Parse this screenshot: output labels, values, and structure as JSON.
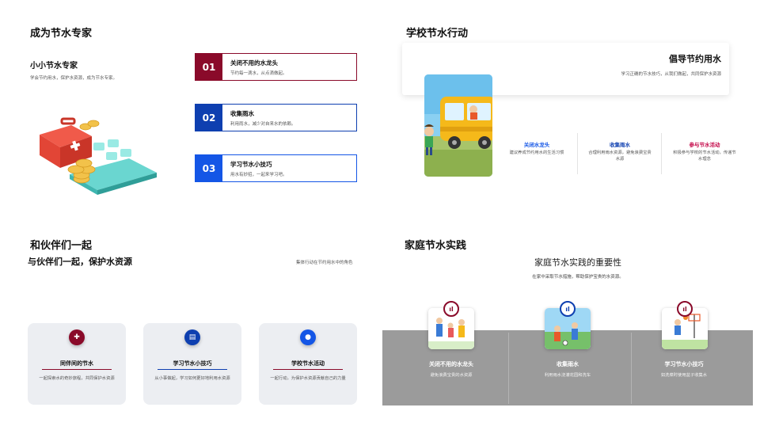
{
  "q1": {
    "title": "成为节水专家",
    "subtitle": "小小节水专家",
    "desc": "学会节约用水，保护水资源，成为节水专家。",
    "steps": [
      {
        "num": "01",
        "title": "关闭不用的水龙头",
        "desc": "节约每一滴水，从点滴做起。",
        "color": "#8a0a2a"
      },
      {
        "num": "02",
        "title": "收集雨水",
        "desc": "利用雨水，减少对自来水的依赖。",
        "color": "#0e3fb0"
      },
      {
        "num": "03",
        "title": "学习节水小技巧",
        "desc": "用水有妙招，一起来学习吧。",
        "color": "#1456e6"
      }
    ]
  },
  "q2": {
    "title": "学校节水行动",
    "card_title": "倡导节约用水",
    "card_desc": "学习正确的节水技巧，从我们做起，共同保护水资源",
    "cols": [
      {
        "title": "关闭水龙头",
        "desc": "建议养成节约用水的生活习惯",
        "color": "#1456e6"
      },
      {
        "title": "收集雨水",
        "desc": "合理利用雨水资源，避免浪费宝贵水源",
        "color": "#0e3fb0"
      },
      {
        "title": "参与节水活动",
        "desc": "积极参与学校的节水活动，传递节水理念",
        "color": "#c40a4a"
      }
    ]
  },
  "q3": {
    "title": "和伙伴们一起",
    "subtitle": "与伙伴们一起，保护水资源",
    "note": "集体行动在节约用水中的角色",
    "cards": [
      {
        "title": "同伴间的节水",
        "desc": "一起探索水的奇妙旅程，共同保护水资源",
        "color": "#8a0a2a",
        "icon": "team-icon"
      },
      {
        "title": "学习节水小技巧",
        "desc": "从小事做起，学习如何更好地利用水资源",
        "color": "#0e3fb0",
        "icon": "clipboard-icon"
      },
      {
        "title": "学校节水活动",
        "desc": "一起行动，为保护水资源贡献自己的力量",
        "color": "#1456e6",
        "icon": "location-icon"
      }
    ]
  },
  "q4": {
    "title": "家庭节水实践",
    "subtitle": "家庭节水实践的重要性",
    "desc": "在家中采取节水措施，帮助保护宝贵的水资源。",
    "items": [
      {
        "title": "关闭不用的水龙头",
        "desc": "避免浪费宝贵的水资源",
        "color": "#8a0a2a"
      },
      {
        "title": "收集雨水",
        "desc": "利用雨水浇灌花园和洗车",
        "color": "#0e3fb0"
      },
      {
        "title": "学习节水小技巧",
        "desc": "如洗菜时使用盆子收集水",
        "color": "#8a0a2a"
      }
    ]
  }
}
